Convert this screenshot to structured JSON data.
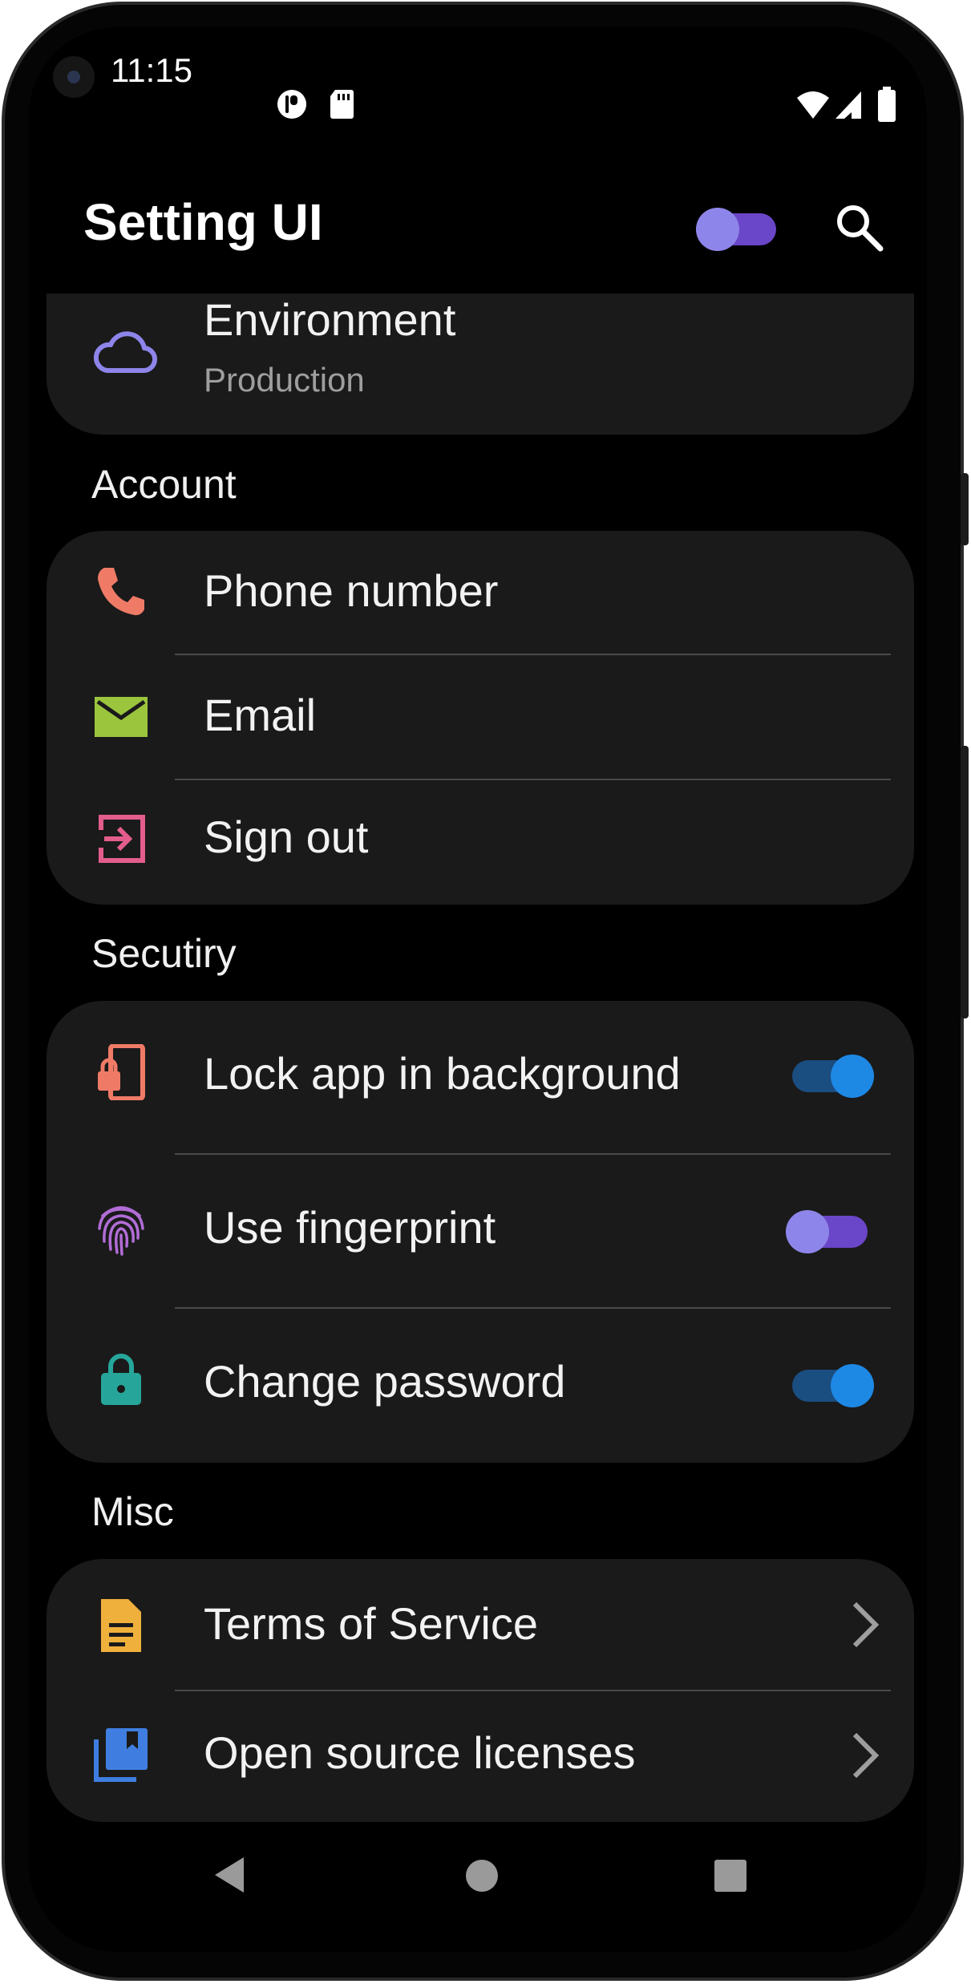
{
  "status_bar": {
    "time": "11:15"
  },
  "app_bar": {
    "title": "Setting UI",
    "theme_toggle_on": true
  },
  "environment": {
    "title": "Environment",
    "value": "Production",
    "icon": "cloud-icon"
  },
  "sections": {
    "account": {
      "title": "Account",
      "items": [
        {
          "label": "Phone number",
          "icon": "phone-icon"
        },
        {
          "label": "Email",
          "icon": "mail-icon"
        },
        {
          "label": "Sign out",
          "icon": "sign-out-icon"
        }
      ]
    },
    "security": {
      "title": "Secutiry",
      "items": [
        {
          "label": "Lock app in background",
          "icon": "phone-lock-icon",
          "toggle_on": true
        },
        {
          "label": "Use fingerprint",
          "icon": "fingerprint-icon",
          "toggle_on": false
        },
        {
          "label": "Change password",
          "icon": "lock-icon",
          "toggle_on": true
        }
      ]
    },
    "misc": {
      "title": "Misc",
      "items": [
        {
          "label": "Terms of Service",
          "icon": "document-icon"
        },
        {
          "label": "Open source licenses",
          "icon": "library-books-icon"
        }
      ]
    }
  },
  "colors": {
    "background": "#000000",
    "card": "#1a1a1a",
    "accent_purple": "#8e7fe8",
    "accent_blue": "#1e88e5",
    "secondary_text": "#9e9e9e"
  }
}
